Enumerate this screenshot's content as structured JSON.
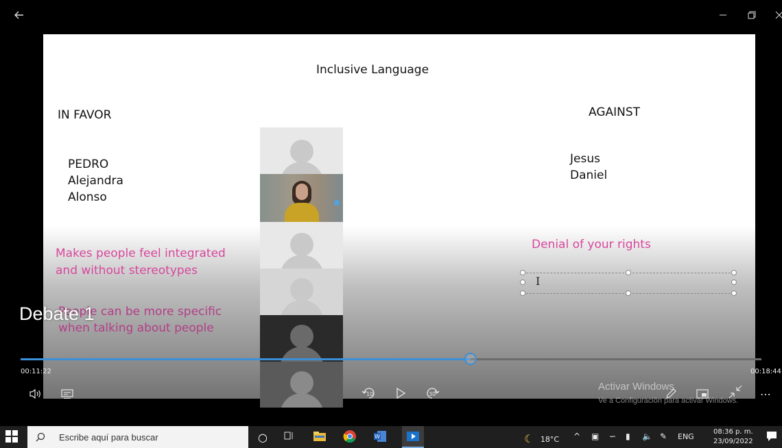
{
  "window": {
    "back_icon": "arrow-left-icon",
    "minimize_icon": "minimize-icon",
    "restore_icon": "restore-icon",
    "close_icon": "close-icon"
  },
  "slide": {
    "title": "Inclusive Language",
    "in_favor_heading": "IN FAVOR",
    "in_favor_names": [
      "PEDRO",
      "Alejandra",
      "Alonso"
    ],
    "against_heading": "AGAINST",
    "against_names": [
      "Jesus",
      "Daniel"
    ],
    "favor_points": [
      [
        "Makes people feel integrated",
        "and without stereotypes"
      ],
      [
        "People can be more specific",
        "when talking about people"
      ]
    ],
    "against_point": "Denial of your rights"
  },
  "video": {
    "title": "Debate 1",
    "current_time": "00:11:22",
    "total_time": "00:18:44",
    "progress": 0.607
  },
  "controls": {
    "volume_icon": "speaker-icon",
    "captions_icon": "captions-icon",
    "rewind_label": "10",
    "play_icon": "play-icon",
    "forward_label": "30",
    "edit_icon": "pencil-icon",
    "miniplayer_icon": "miniplayer-icon",
    "fullscreen_icon": "exit-fullscreen-icon",
    "more_icon": "more-icon"
  },
  "watermark": {
    "line1": "Activar Windows",
    "line2": "Ve a Configuración para activar Windows."
  },
  "taskbar": {
    "search_placeholder": "Escribe aquí para buscar",
    "temperature": "18°C",
    "language": "ENG",
    "time": "08:36 p. m.",
    "date": "23/09/2022"
  },
  "colors": {
    "accent": "#3a8fd9",
    "pink_text": "#d8479d"
  }
}
